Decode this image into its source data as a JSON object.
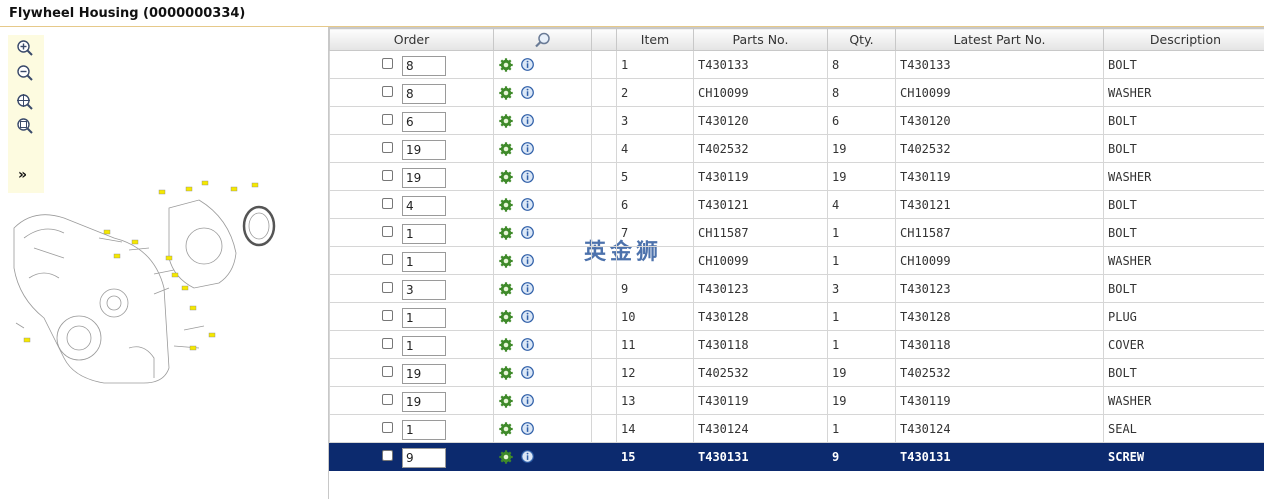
{
  "page": {
    "title": "Flywheel Housing (0000000334)"
  },
  "toolbar": {
    "expand_label": "»"
  },
  "table": {
    "headers": {
      "order": "Order",
      "item": "Item",
      "parts_no": "Parts No.",
      "qty": "Qty.",
      "latest": "Latest Part No.",
      "description": "Description"
    },
    "rows": [
      {
        "order_qty": "8",
        "item": "1",
        "parts_no": "T430133",
        "qty": "8",
        "latest": "T430133",
        "description": "BOLT"
      },
      {
        "order_qty": "8",
        "item": "2",
        "parts_no": "CH10099",
        "qty": "8",
        "latest": "CH10099",
        "description": "WASHER"
      },
      {
        "order_qty": "6",
        "item": "3",
        "parts_no": "T430120",
        "qty": "6",
        "latest": "T430120",
        "description": "BOLT"
      },
      {
        "order_qty": "19",
        "item": "4",
        "parts_no": "T402532",
        "qty": "19",
        "latest": "T402532",
        "description": "BOLT"
      },
      {
        "order_qty": "19",
        "item": "5",
        "parts_no": "T430119",
        "qty": "19",
        "latest": "T430119",
        "description": "WASHER"
      },
      {
        "order_qty": "4",
        "item": "6",
        "parts_no": "T430121",
        "qty": "4",
        "latest": "T430121",
        "description": "BOLT"
      },
      {
        "order_qty": "1",
        "item": "7",
        "parts_no": "CH11587",
        "qty": "1",
        "latest": "CH11587",
        "description": "BOLT"
      },
      {
        "order_qty": "1",
        "item": "",
        "parts_no": "CH10099",
        "qty": "1",
        "latest": "CH10099",
        "description": "WASHER"
      },
      {
        "order_qty": "3",
        "item": "9",
        "parts_no": "T430123",
        "qty": "3",
        "latest": "T430123",
        "description": "BOLT"
      },
      {
        "order_qty": "1",
        "item": "10",
        "parts_no": "T430128",
        "qty": "1",
        "latest": "T430128",
        "description": "PLUG"
      },
      {
        "order_qty": "1",
        "item": "11",
        "parts_no": "T430118",
        "qty": "1",
        "latest": "T430118",
        "description": "COVER"
      },
      {
        "order_qty": "19",
        "item": "12",
        "parts_no": "T402532",
        "qty": "19",
        "latest": "T402532",
        "description": "BOLT"
      },
      {
        "order_qty": "19",
        "item": "13",
        "parts_no": "T430119",
        "qty": "19",
        "latest": "T430119",
        "description": "WASHER"
      },
      {
        "order_qty": "1",
        "item": "14",
        "parts_no": "T430124",
        "qty": "1",
        "latest": "T430124",
        "description": "SEAL"
      },
      {
        "order_qty": "9",
        "item": "15",
        "parts_no": "T430131",
        "qty": "9",
        "latest": "T430131",
        "description": "SCREW",
        "selected": true
      }
    ]
  },
  "watermark": "英金狮",
  "colors": {
    "selected_row": "#0c2a6e",
    "toolbar_bg": "#fdfbe0",
    "callout_yellow": "#f5e800",
    "gear_green": "#3f8a2a",
    "info_blue": "#2f5fa8"
  },
  "icons": {
    "zoom_in": "zoom-in-icon",
    "zoom_out": "zoom-out-icon",
    "zoom_fit": "zoom-extents-icon",
    "zoom_window": "zoom-window-icon",
    "search": "magnifier-icon",
    "detail": "gear-icon",
    "info": "info-icon"
  }
}
